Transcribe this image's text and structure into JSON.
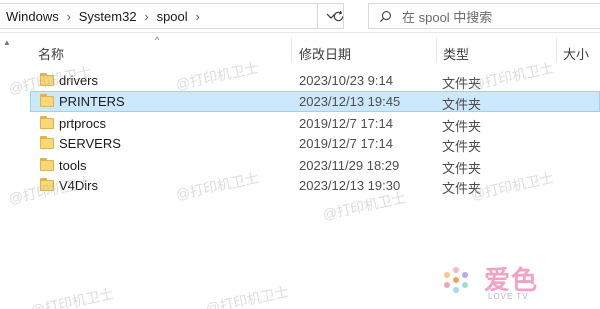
{
  "breadcrumb": [
    "Windows",
    "System32",
    "spool"
  ],
  "search": {
    "placeholder": "在 spool 中搜索"
  },
  "columns": {
    "name": "名称",
    "date": "修改日期",
    "type": "类型",
    "size": "大小"
  },
  "files": [
    {
      "name": "drivers",
      "date": "2023/10/23 9:14",
      "type": "文件夹",
      "selected": false
    },
    {
      "name": "PRINTERS",
      "date": "2023/12/13 19:45",
      "type": "文件夹",
      "selected": true
    },
    {
      "name": "prtprocs",
      "date": "2019/12/7 17:14",
      "type": "文件夹",
      "selected": false
    },
    {
      "name": "SERVERS",
      "date": "2019/12/7 17:14",
      "type": "文件夹",
      "selected": false
    },
    {
      "name": "tools",
      "date": "2023/11/29 18:29",
      "type": "文件夹",
      "selected": false
    },
    {
      "name": "V4Dirs",
      "date": "2023/12/13 19:30",
      "type": "文件夹",
      "selected": false
    }
  ],
  "watermark": "@打印机卫士",
  "logo": {
    "title": "爱色",
    "subtitle": "LOVE TV"
  },
  "colors": {
    "selection": "#cce8ff",
    "selection_border": "#99d1ff",
    "folder": "#f8d775"
  },
  "icons": {
    "chevron": "chevron-right-icon",
    "dropdown": "chevron-down-icon",
    "refresh": "refresh-icon",
    "search": "search-icon",
    "folder": "folder-icon"
  }
}
